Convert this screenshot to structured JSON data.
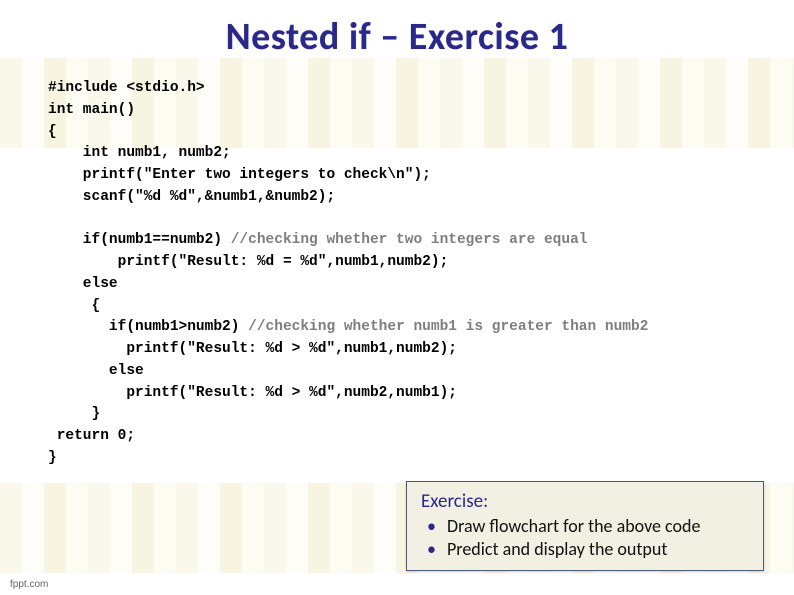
{
  "slide": {
    "title": "Nested if – Exercise 1"
  },
  "code": {
    "l1": "#include <stdio.h>",
    "l2": "int main()",
    "l3": "{",
    "l4": "    int numb1, numb2;",
    "l5": "    printf(\"Enter two integers to check\\n\");",
    "l6": "    scanf(\"%d %d\",&numb1,&numb2);",
    "blank": "",
    "l7a": "    if(numb1==numb2) ",
    "l7c": "//checking whether two integers are equal",
    "l8": "        printf(\"Result: %d = %d\",numb1,numb2);",
    "l9": "    else",
    "l10": "     {",
    "l11a": "       if(numb1>numb2) ",
    "l11c": "//checking whether numb1 is greater than numb2",
    "l12": "         printf(\"Result: %d > %d\",numb1,numb2);",
    "l13": "       else",
    "l14": "         printf(\"Result: %d > %d\",numb2,numb1);",
    "l15": "     }",
    "l16": " return 0;",
    "l17": "}"
  },
  "exercise": {
    "heading": "Exercise:",
    "items": [
      "Draw flowchart for the above code",
      "Predict and display the output"
    ]
  },
  "footer": {
    "brand": "fppt.com"
  }
}
